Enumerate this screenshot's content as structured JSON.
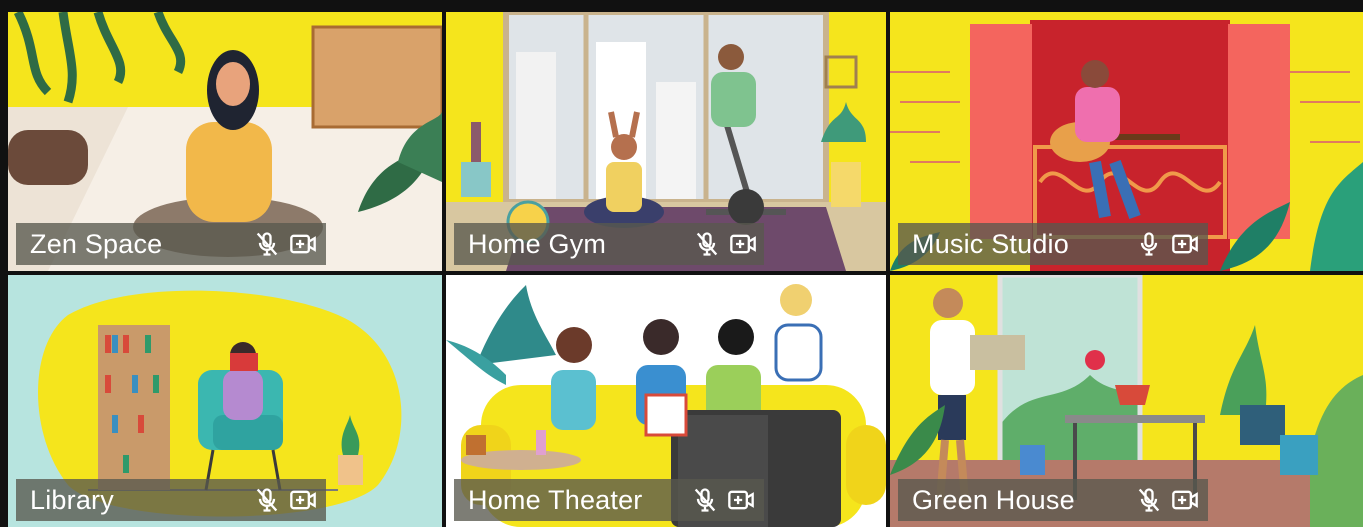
{
  "rooms": [
    {
      "label": "Zen Space",
      "mic_icon": "mic-muted-icon",
      "camera_icon": "camera-add-icon",
      "bg": "#f5e51c"
    },
    {
      "label": "Home Gym",
      "mic_icon": "mic-muted-icon",
      "camera_icon": "camera-add-icon",
      "bg": "#f5e51c"
    },
    {
      "label": "Music Studio",
      "mic_icon": "mic-icon",
      "camera_icon": "camera-add-icon",
      "bg": "#f5e51c"
    },
    {
      "label": "Library",
      "mic_icon": "mic-muted-icon",
      "camera_icon": "camera-add-icon",
      "bg": "#b7e4df"
    },
    {
      "label": "Home Theater",
      "mic_icon": "mic-muted-icon",
      "camera_icon": "camera-add-icon",
      "bg": "#ffffff"
    },
    {
      "label": "Green House",
      "mic_icon": "mic-muted-icon",
      "camera_icon": "camera-add-icon",
      "bg": "#f5e51c"
    }
  ]
}
